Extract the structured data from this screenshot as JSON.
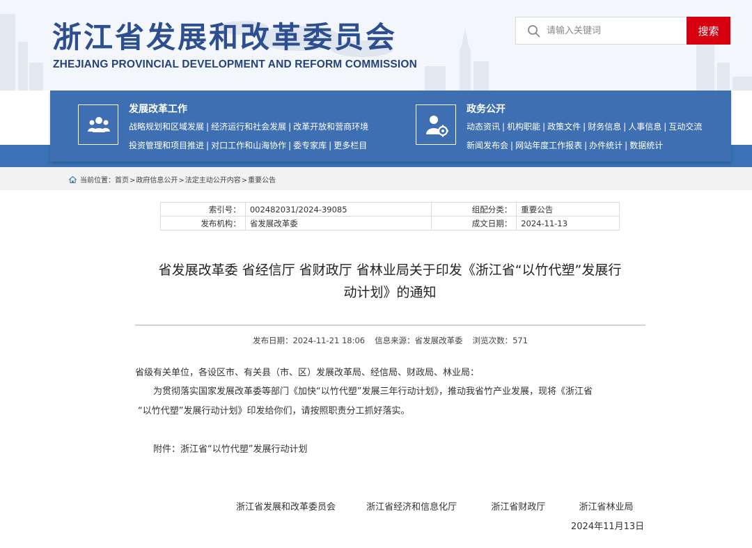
{
  "site": {
    "title": "浙江省发展和改革委员会",
    "subtitle": "ZHEJIANG PROVINCIAL DEVELOPMENT AND REFORM COMMISSION"
  },
  "search": {
    "placeholder": "请输入关键词",
    "button_label": "搜索"
  },
  "nav": {
    "groups": [
      {
        "title": "发展改革工作",
        "icon": "people-group-icon",
        "line1": [
          "战略规划和区域发展",
          "经济运行和社会发展",
          "改革开放和营商环境"
        ],
        "line2": [
          "投资管理和项目推进",
          "对口工作和山海协作",
          "委专家库",
          "更多栏目"
        ]
      },
      {
        "title": "政务公开",
        "icon": "user-settings-icon",
        "line1": [
          "动态资讯",
          "机构职能",
          "政策文件",
          "财务信息",
          "人事信息",
          "互动交流"
        ],
        "line2": [
          "新闻发布会",
          "网站年度工作报表",
          "办件统计",
          "数据统计"
        ]
      }
    ],
    "separator": "|"
  },
  "breadcrumb": {
    "prefix": "当前位置：",
    "items": [
      "首页",
      "政府信息公开",
      "法定主动公开内容",
      "重要公告"
    ],
    "separator": ">"
  },
  "meta": {
    "index_label": "索引号：",
    "index_value": "002482031/2024-39085",
    "category_label": "组配分类：",
    "category_value": "重要公告",
    "publisher_label": "发布机构：",
    "publisher_value": "省发展改革委",
    "created_label": "成文日期：",
    "created_value": "2024-11-13"
  },
  "article": {
    "title_line1": "省发展改革委 省经信厅 省财政厅 省林业局关于印发《浙江省“以竹代塑”发展行",
    "title_line2": "动计划》的通知",
    "pub_date": "发布日期：2024-11-21 18:06",
    "source": "信息来源：省发展改革委",
    "views": "浏览次数：571",
    "addressee": "省级有关单位，各设区市、有关县（市、区）发展改革局、经信局、财政局、林业局：",
    "para1_line1": "为贯彻落实国家发展改革委等部门《加快“以竹代塑”发展三年行动计划》，推动我省竹产业发展，现将《浙江省",
    "para1_line2": "“以竹代塑”发展行动计划》印发给你们，请按照职责分工抓好落实。",
    "attachment": "附件：浙江省“以竹代塑”发展行动计划",
    "signers": [
      "浙江省发展和改革委员会",
      "浙江省经济和信息化厅",
      "浙江省财政厅",
      "浙江省林业局"
    ],
    "date": "2024年11月13日"
  },
  "colors": {
    "brand_blue": "#2d4f8f",
    "nav_blue": "#3e6fb3",
    "search_red": "#d7000f"
  }
}
